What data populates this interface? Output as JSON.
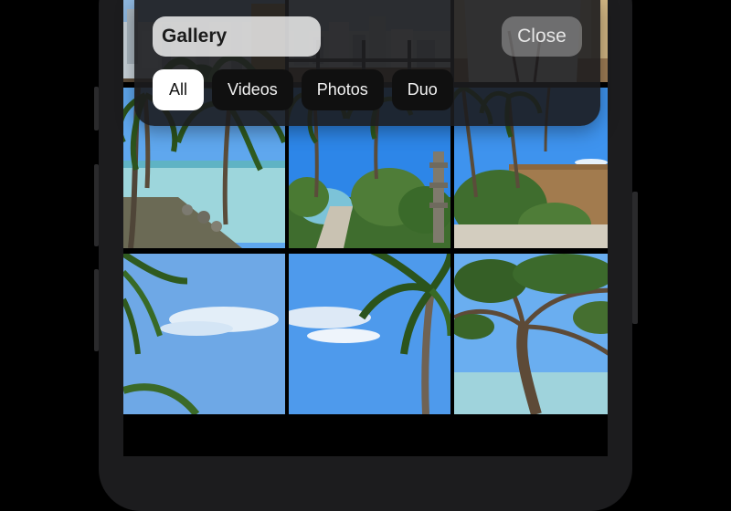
{
  "header": {
    "search_value": "Gallery",
    "close_label": "Close"
  },
  "filters": [
    {
      "label": "All",
      "active": true
    },
    {
      "label": "Videos",
      "active": false
    },
    {
      "label": "Photos",
      "active": false
    },
    {
      "label": "Duo",
      "active": false
    }
  ],
  "gallery": {
    "thumbnails": [
      {
        "scene": "city-skyline-balcony"
      },
      {
        "scene": "city-balcony-planter"
      },
      {
        "scene": "planter-wall"
      },
      {
        "scene": "palm-beach-rocks"
      },
      {
        "scene": "palm-garden-path"
      },
      {
        "scene": "palm-garden-fence"
      },
      {
        "scene": "palm-leaves-sky"
      },
      {
        "scene": "palm-tree-beach"
      },
      {
        "scene": "tree-branches-sea"
      }
    ]
  },
  "colors": {
    "overlay_bg": "#1c1c1e",
    "active_tab_bg": "#ffffff",
    "tab_bg": "#101010",
    "sky": "#3a8ee6",
    "sea": "#9fd6dd",
    "foliage": "#3a6a2a"
  }
}
